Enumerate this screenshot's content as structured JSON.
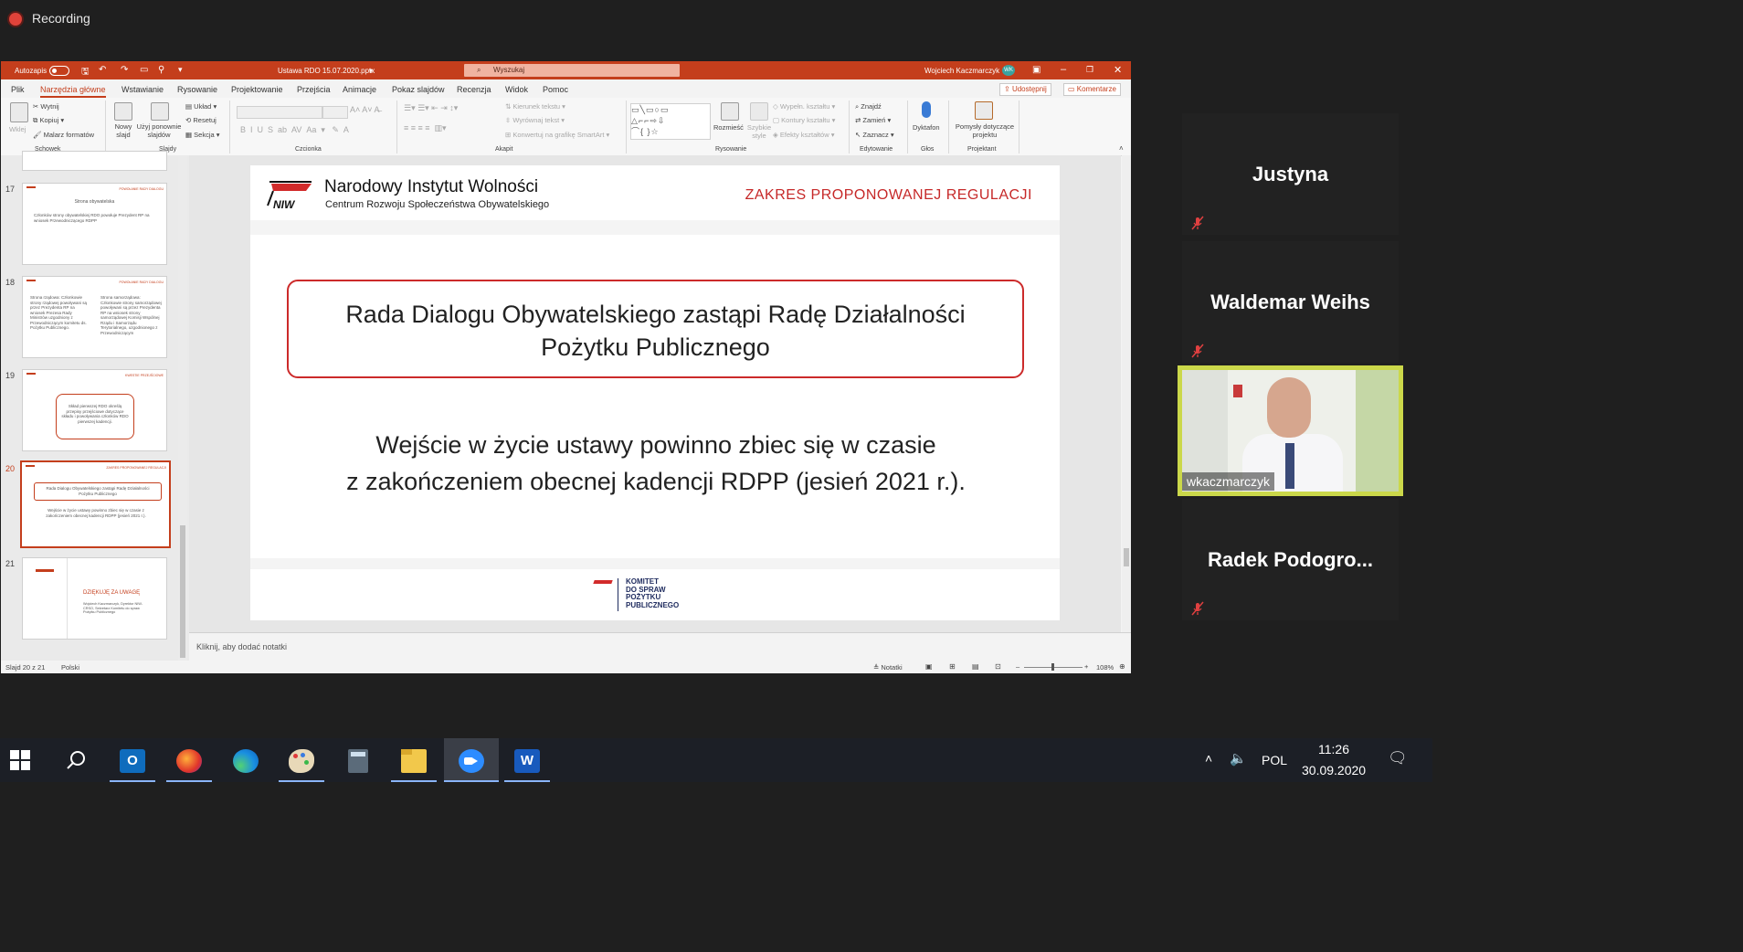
{
  "recording": {
    "label": "Recording"
  },
  "ppt": {
    "titlebar": {
      "autosave_label": "Autozapis",
      "filename": "Ustawa RDO 15.07.2020.pptx",
      "search_placeholder": "Wyszukaj",
      "user_name": "Wojciech Kaczmarczyk",
      "user_initials": "WK"
    },
    "menu": {
      "tabs": [
        "Plik",
        "Narzędzia główne",
        "Wstawianie",
        "Rysowanie",
        "Projektowanie",
        "Przejścia",
        "Animacje",
        "Pokaz slajdów",
        "Recenzja",
        "Widok",
        "Pomoc"
      ],
      "share_label": "Udostępnij",
      "comments_label": "Komentarze"
    },
    "ribbon": {
      "paste": "Wklej",
      "cut": "Wytnij",
      "copy": "Kopiuj",
      "format_painter": "Malarz formatów",
      "clipboard_group": "Schowek",
      "new_slide": "Nowy slajd",
      "reuse_slides": "Użyj ponownie slajdów",
      "layout": "Układ",
      "reset": "Resetuj",
      "section": "Sekcja",
      "slides_group": "Slajdy",
      "font_group": "Czcionka",
      "text_direction": "Kierunek tekstu",
      "align_text": "Wyrównaj tekst",
      "convert_smartart": "Konwertuj na grafikę SmartArt",
      "paragraph_group": "Akapit",
      "arrange": "Rozmieść",
      "quick_styles": "Szybkie style",
      "shape_fill": "Wypełn. kształtu",
      "shape_outline": "Kontury kształtu",
      "shape_effects": "Efekty kształtów",
      "drawing_group": "Rysowanie",
      "find": "Znajdź",
      "replace": "Zamień",
      "select": "Zaznacz",
      "editing_group": "Edytowanie",
      "dictate": "Dyktafon",
      "voice_group": "Głos",
      "design_ideas": "Pomysły dotyczące projektu",
      "designer_group": "Projektant"
    },
    "thumbnails": [
      {
        "num": "17",
        "header": "POWOŁANIE RADY DIALOGU",
        "title": "Strona obywatelska",
        "body": "Członków strony obywatelskiej RDO powołuje Prezydent RP na wniosek Przewodniczącego RDPP"
      },
      {
        "num": "18",
        "header": "POWOŁANIE RADY DIALOGU",
        "left": "Strona rządowa: Członkowie strony rządowej powoływani są przez Prezydenta RP na wniosek Prezesa Rady Ministrów uzgodniony z Przewodniczącym komitetu ds. Pożytku Publicznego.",
        "right": "Strona samorządowa: Członkowie strony samorządowej powoływani są przez Prezydenta RP na wniosek strony samorządowej Komisji Wspólnej Rządu i Samorządu Terytorialnego, uzgodnionego z Przewodniczącym"
      },
      {
        "num": "19",
        "header": "KWESTIE PRZEJŚCIOWE",
        "body": "Skład pierwszej RDO określą przepisy przejściowe dotyczące składu i powoływania członków RDO pierwszej kadencji."
      },
      {
        "num": "20",
        "header": "ZAKRES PROPONOWANEJ REGULACJI",
        "box": "Rada Dialogu Obywatelskiego zastąpi Radę Działalności Pożytku Publicznego",
        "body": "Wejście w życie ustawy powinno zbiec się w czasie z zakończeniem obecnej kadencji RDPP (jesień 2021 r.)."
      },
      {
        "num": "21",
        "title": "DZIĘKUJĘ ZA UWAGĘ",
        "body": "Wojciech Kaczmarczyk, Dyrektor NIW-CRSO, Sekretarz Komitetu do spraw Pożytku Publicznego"
      }
    ],
    "slide": {
      "org_name": "Narodowy Instytut Wolności",
      "org_sub": "Centrum Rozwoju Społeczeństwa Obywatelskiego",
      "logo_text": "NIW",
      "header_title": "ZAKRES PROPONOWANEJ REGULACJI",
      "box_text_1": "Rada Dialogu Obywatelskiego zastąpi Radę Działalności",
      "box_text_2": "Pożytku Publicznego",
      "body_1": "Wejście w życie ustawy powinno zbiec się w czasie",
      "body_2": "z zakończeniem obecnej kadencji RDPP (jesień 2021 r.).",
      "footer_logo": [
        "KOMITET",
        "DO SPRAW",
        "POŻYTKU",
        "PUBLICZNEGO"
      ]
    },
    "notes_placeholder": "Kliknij, aby dodać notatki",
    "status": {
      "slide_counter": "Slajd 20 z 21",
      "language": "Polski",
      "notes": "Notatki",
      "zoom": "108%"
    },
    "colors": {
      "accent": "#c43e1c",
      "slide_red": "#cc2a2a"
    }
  },
  "participants": [
    {
      "name": "Justyna",
      "muted": true
    },
    {
      "name": "Waldemar Weihs",
      "muted": true
    },
    {
      "name": "wkaczmarczyk",
      "video": true,
      "speaking": true
    },
    {
      "name": "Radek  Podogro...",
      "muted": true
    }
  ],
  "taskbar": {
    "apps": [
      "start-icon",
      "search-icon",
      "outlook-icon",
      "firefox-icon",
      "edge-icon",
      "paint-icon",
      "calculator-icon",
      "file-explorer-icon",
      "zoom-icon",
      "word-icon"
    ],
    "language": "POL",
    "time": "11:26",
    "date": "30.09.2020"
  }
}
